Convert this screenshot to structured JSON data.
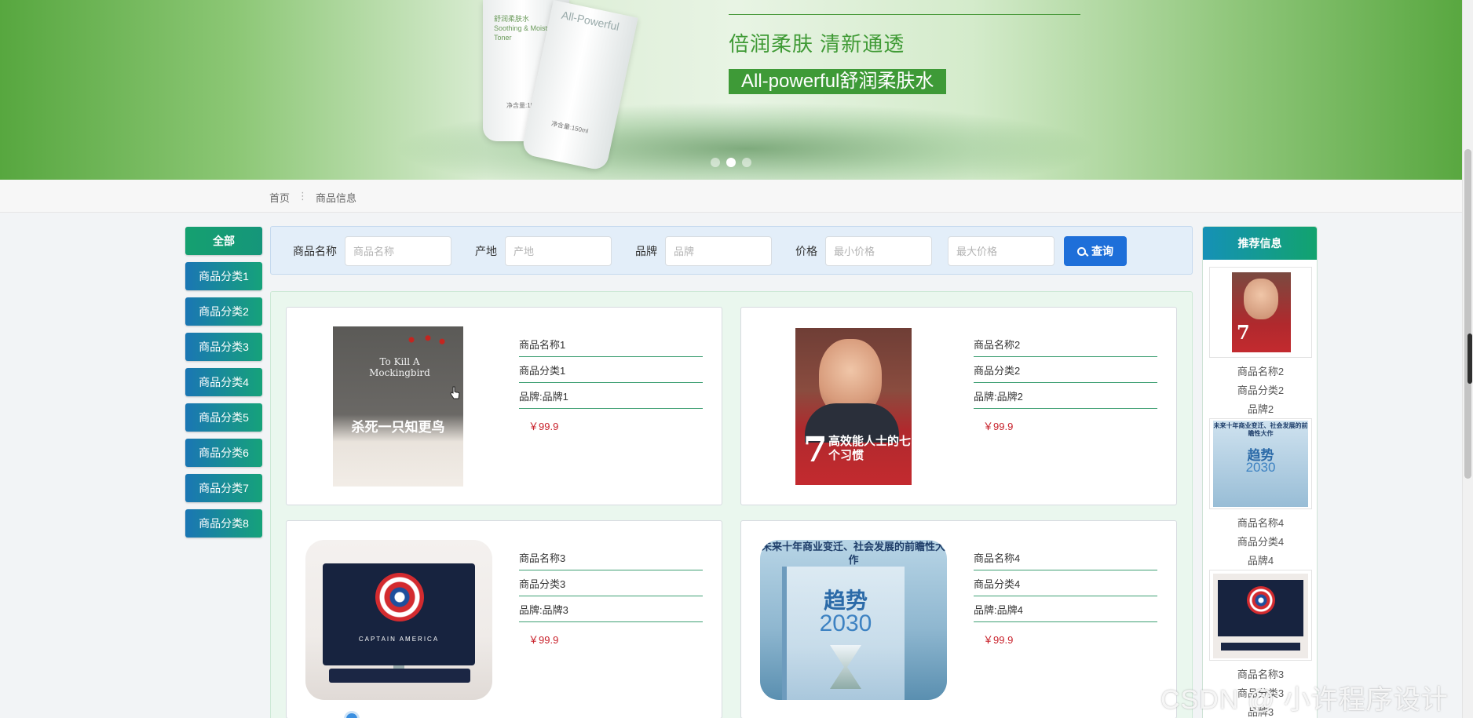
{
  "banner": {
    "slogan": "倍润柔肤 清新通透",
    "product_tag": "All-powerful舒润柔肤水",
    "bottle_label": "舒润柔肤水\nSoothing & Moisturizing\nToner",
    "bottle_brand": "All-Powerful",
    "bottle_volume": "净含量:150ml",
    "slides_total": 3,
    "slides_active": 2
  },
  "breadcrumb": {
    "home": "首页",
    "separator": "⋮",
    "current": "商品信息"
  },
  "categories": {
    "all": "全部",
    "items": [
      "商品分类1",
      "商品分类2",
      "商品分类3",
      "商品分类4",
      "商品分类5",
      "商品分类6",
      "商品分类7",
      "商品分类8"
    ]
  },
  "search": {
    "name_label": "商品名称",
    "name_placeholder": "商品名称",
    "origin_label": "产地",
    "origin_placeholder": "产地",
    "brand_label": "品牌",
    "brand_placeholder": "品牌",
    "price_label": "价格",
    "price_min_placeholder": "最小价格",
    "price_max_placeholder": "最大价格",
    "query_label": "查询",
    "query_icon": "search-icon"
  },
  "products": [
    {
      "name": "商品名称1",
      "category": "商品分类1",
      "brand": "品牌:品牌1",
      "price": "￥99.9",
      "cover_title": "To Kill A Mockingbird",
      "cover_cn": "杀死一只知更鸟"
    },
    {
      "name": "商品名称2",
      "category": "商品分类2",
      "brand": "品牌:品牌2",
      "price": "￥99.9",
      "cover_cn": "高效能人士的七个习惯"
    },
    {
      "name": "商品名称3",
      "category": "商品分类3",
      "brand": "品牌:品牌3",
      "price": "￥99.9",
      "cover_caption": "CAPTAIN AMERICA"
    },
    {
      "name": "商品名称4",
      "category": "商品分类4",
      "brand": "品牌:品牌4",
      "price": "￥99.9",
      "cover_header": "未来十年商业变迁、社会发展的前瞻性大作",
      "cover_title": "趋势",
      "cover_year": "2030"
    }
  ],
  "recommend": {
    "title": "推荐信息",
    "items": [
      {
        "name": "商品名称2",
        "category": "商品分类2",
        "brand": "品牌2"
      },
      {
        "name": "商品名称4",
        "category": "商品分类4",
        "brand": "品牌4"
      },
      {
        "name": "商品名称3",
        "category": "商品分类3",
        "brand": "品牌3"
      }
    ]
  },
  "watermark": "CSDN @ 小许程序设计",
  "colors": {
    "accent_blue": "#1e6fd9",
    "category_gradient_start": "#1a76b4",
    "category_gradient_end": "#16a27a",
    "price_red": "#c8202a",
    "banner_green": "#3e9a37"
  }
}
